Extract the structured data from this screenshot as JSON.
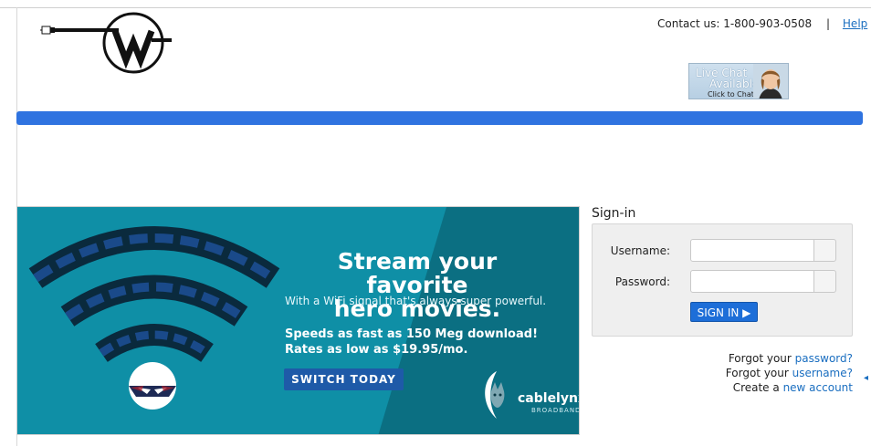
{
  "header": {
    "contact_label": "Contact us: 1-800-903-0508",
    "separator": "|",
    "help_link": "Help"
  },
  "live_chat": {
    "line1": "Live Chat",
    "line2": "Available",
    "line3": "Click to Chat"
  },
  "banner": {
    "headline_line1": "Stream your favorite",
    "headline_line2": "hero movies.",
    "subheadline": "With a WiFi signal that's always super powerful.",
    "speeds_line1": "Speeds as fast as 150 Meg download!",
    "speeds_line2": "Rates as low as $19.95/mo.",
    "cta_button": "SWITCH TODAY",
    "brand_name": "cablelynx",
    "brand_sub": "BROADBAND"
  },
  "signin": {
    "title": "Sign-in",
    "username_label": "Username:",
    "password_label": "Password:",
    "username_value": "",
    "password_value": "",
    "button_label": "SIGN IN ▶"
  },
  "links": {
    "forgot_prefix": "Forgot your",
    "password_link": "password?",
    "username_link": "username?",
    "create_prefix": "Create a",
    "new_account_link": "new account"
  },
  "colors": {
    "accent_bar": "#2f73e0",
    "banner_bg": "#0f8fa6",
    "link": "#1a6ec0",
    "cta": "#1e5aa8"
  },
  "icons": [
    "wave-logo-icon",
    "chat-agent-avatar",
    "wifi-icon",
    "mascot-icon",
    "lynx-logo-icon",
    "play-triangle-icon"
  ]
}
